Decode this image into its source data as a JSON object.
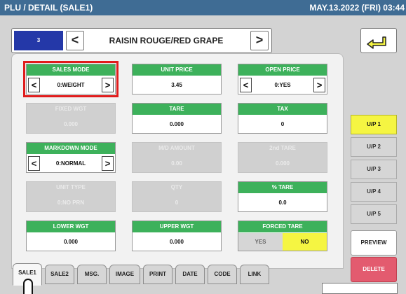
{
  "header": {
    "title": "PLU / DETAIL (SALE1)",
    "datetime": "MAY.13.2022 (FRI) 03:44"
  },
  "plu": {
    "number": "3",
    "name": "RAISIN ROUGE/RED GRAPE",
    "prev_icon": "<",
    "next_icon": ">"
  },
  "back_icon": "return-arrow-icon",
  "fields": {
    "sales_mode": {
      "label": "SALES MODE",
      "value": "0:WEIGHT"
    },
    "unit_price": {
      "label": "UNIT PRICE",
      "value": "3.45"
    },
    "open_price": {
      "label": "OPEN PRICE",
      "value": "0:YES"
    },
    "fixed_wgt": {
      "label": "FIXED WGT",
      "value": "0.000"
    },
    "tare": {
      "label": "TARE",
      "value": "0.000"
    },
    "tax": {
      "label": "TAX",
      "value": "0"
    },
    "markdown_mode": {
      "label": "MARKDOWN MODE",
      "value": "0:NORMAL"
    },
    "md_amount": {
      "label": "M/D AMOUNT",
      "value": "0.00"
    },
    "second_tare": {
      "label": "2nd TARE",
      "value": "0.000"
    },
    "unit_type": {
      "label": "UNIT TYPE",
      "value": "0:NO PRN"
    },
    "qty": {
      "label": "QTY",
      "value": "0"
    },
    "pct_tare": {
      "label": "% TARE",
      "value": "0.0"
    },
    "lower_wgt": {
      "label": "LOWER WGT",
      "value": "0.000"
    },
    "upper_wgt": {
      "label": "UPPER WGT",
      "value": "0.000"
    },
    "forced_tare": {
      "label": "FORCED TARE",
      "yes": "YES",
      "no": "NO"
    }
  },
  "arrows": {
    "left": "<",
    "right": ">"
  },
  "unit_price_tabs": [
    "U/P 1",
    "U/P 2",
    "U/P 3",
    "U/P 4",
    "U/P 5"
  ],
  "buttons": {
    "preview": "PREVIEW",
    "delete": "DELETE"
  },
  "tabs": [
    "SALE1",
    "SALE2",
    "MSG.",
    "IMAGE",
    "PRINT",
    "DATE",
    "CODE",
    "LINK"
  ],
  "colors": {
    "header": "#3f6c94",
    "field_label": "#3db15b",
    "highlight": "#e01c1c",
    "selected_tab": "#f5f542",
    "delete": "#e35b6f",
    "plu_number_bg": "#2438a8"
  }
}
